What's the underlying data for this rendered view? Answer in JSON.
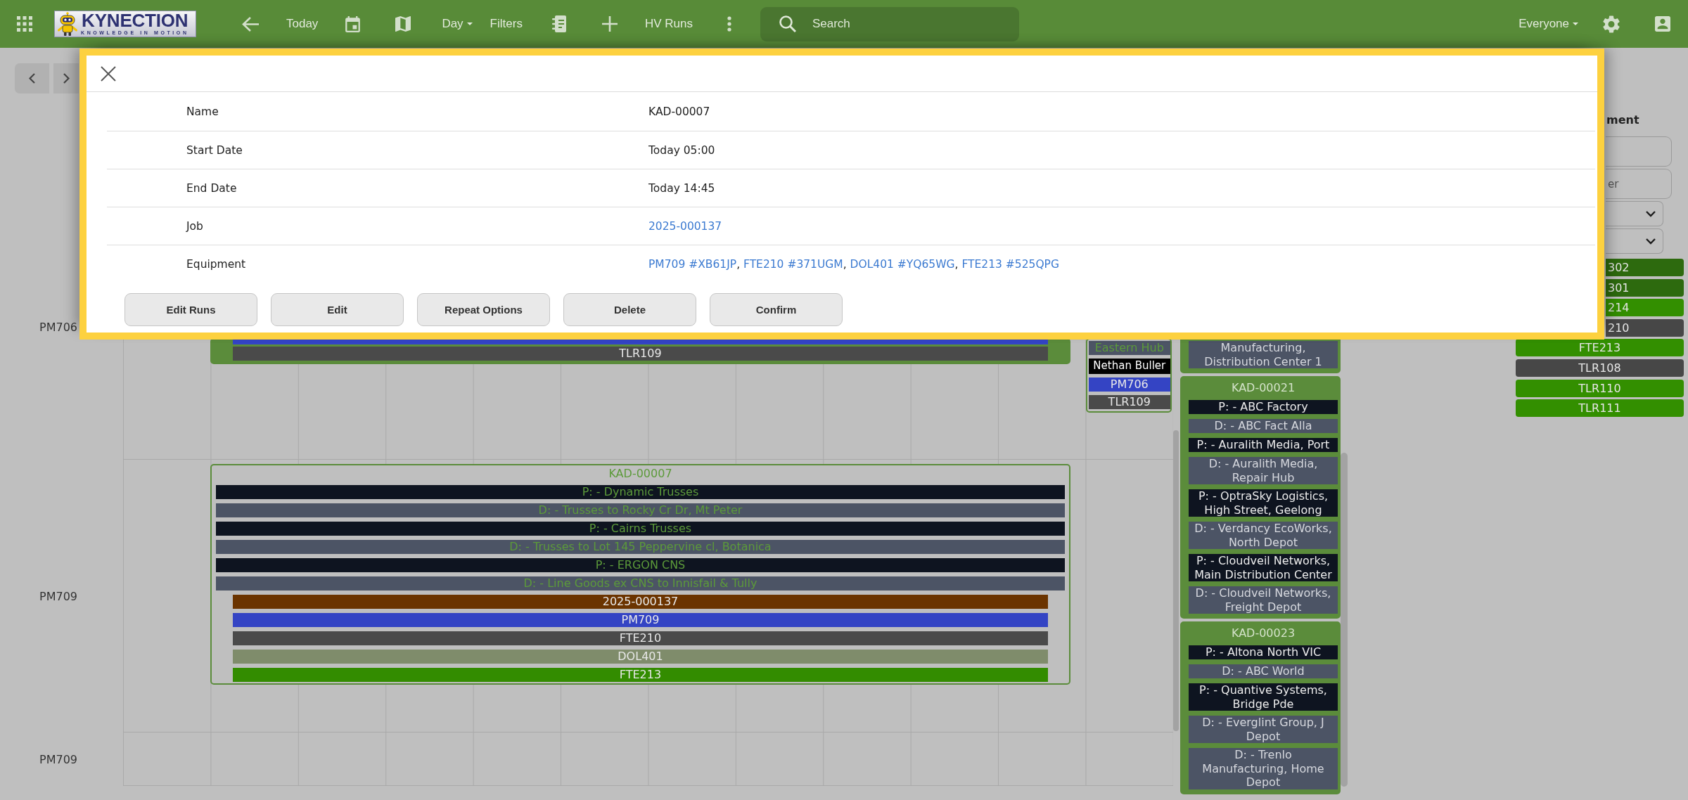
{
  "top_bar": {
    "logo": {
      "wordmark": "KYNECTION",
      "tagline": "KNOWLEDGE IN MOTION"
    },
    "today": "Today",
    "view": "Day",
    "filters": "Filters",
    "runs": "HV Runs",
    "search": {
      "placeholder": "Search"
    },
    "user_filter": "Everyone"
  },
  "calendar": {
    "rows": [
      {
        "label": "PM706",
        "cards": [
          {
            "confirmed": true,
            "items": [
              {
                "kind": "equipment",
                "color": "#3444c4"
              },
              {
                "kind": "equipment",
                "label": "TLR109",
                "color": "#4a4a4a"
              }
            ]
          },
          {
            "confirmed": false,
            "items": [
              {
                "kind": "drop",
                "label": "Eastern Hub"
              },
              {
                "kind": "driver",
                "label": "Nethan Buller"
              },
              {
                "kind": "equipment",
                "label": "PM706",
                "color": "#3444c4"
              },
              {
                "kind": "equipment",
                "label": "TLR109",
                "color": "#4a4a4a"
              }
            ]
          }
        ]
      },
      {
        "label": "PM709",
        "cards": [
          {
            "title": "KAD-00007",
            "confirmed": false,
            "items": [
              {
                "kind": "pickup",
                "label": "P: - Dynamic Trusses"
              },
              {
                "kind": "drop",
                "label": "D: - Trusses to Rocky Cr Dr, Mt Peter"
              },
              {
                "kind": "pickup",
                "label": "P: - Cairns Trusses"
              },
              {
                "kind": "drop",
                "label": "D: - Trusses to Lot 145 Peppervine cl, Botanica"
              },
              {
                "kind": "pickup",
                "label": "P: - ERGON CNS"
              },
              {
                "kind": "drop",
                "label": "D: - Line Goods ex CNS to Innisfail & Tully"
              },
              {
                "kind": "equipment",
                "label": "2025-000137",
                "color": "#6b3400"
              },
              {
                "kind": "equipment",
                "label": "PM709",
                "color": "#3444c4"
              },
              {
                "kind": "equipment",
                "label": "FTE210",
                "color": "#4a4a4a"
              },
              {
                "kind": "equipment",
                "label": "DOL401",
                "color": "#7f8c6b"
              },
              {
                "kind": "equipment",
                "label": "FTE213",
                "color": "#338c00"
              }
            ]
          }
        ]
      },
      {
        "label": "PM709"
      }
    ]
  },
  "unassigned": {
    "cards": [
      {
        "confirmed": true,
        "items": [
          {
            "kind": "drop",
            "label": "Manufacturing, Distribution Center 1"
          }
        ]
      },
      {
        "title": "KAD-00021",
        "confirmed": true,
        "items": [
          {
            "kind": "pickup",
            "label": "P: - ABC Factory"
          },
          {
            "kind": "drop",
            "label": "D: - ABC Fact Alla"
          },
          {
            "kind": "pickup",
            "label": "P: - Auralith Media, Port"
          },
          {
            "kind": "drop",
            "label": "D: - Auralith Media, Repair Hub"
          },
          {
            "kind": "pickup",
            "label": "P: - OptraSky Logistics, High Street, Geelong"
          },
          {
            "kind": "drop",
            "label": "D: - Verdancy EcoWorks, North Depot"
          },
          {
            "kind": "pickup",
            "label": "P: - Cloudveil Networks, Main Distribution Center"
          },
          {
            "kind": "drop",
            "label": "D: - Cloudveil Networks, Freight Depot"
          }
        ]
      },
      {
        "title": "KAD-00023",
        "confirmed": true,
        "items": [
          {
            "kind": "pickup",
            "label": "P: - Altona North VIC"
          },
          {
            "kind": "drop",
            "label": "D: - ABC World"
          },
          {
            "kind": "pickup",
            "label": "P: - Quantive Systems, Bridge Pde"
          },
          {
            "kind": "drop",
            "label": "D: - Everglint Group, J Depot"
          },
          {
            "kind": "drop",
            "label": "D: - Trenlo Manufacturing, Home Depot"
          }
        ]
      }
    ]
  },
  "equipment_panel": {
    "heading": "ment",
    "fields": [
      {
        "kind": "input"
      },
      {
        "kind": "input",
        "placeholder": "er"
      },
      {
        "kind": "select"
      },
      {
        "kind": "select"
      }
    ],
    "tags": [
      {
        "label": "302",
        "color": "#2d6a0e",
        "covered": true
      },
      {
        "label": "301",
        "color": "#2d6a0e",
        "covered": true
      },
      {
        "label": "214",
        "color": "#338f00",
        "covered": true
      },
      {
        "label": "210",
        "color": "#474747",
        "covered": true
      },
      {
        "label": "FTE213",
        "color": "#338f00",
        "covered": false
      },
      {
        "label": "TLR108",
        "color": "#474747",
        "covered": false
      },
      {
        "label": "TLR110",
        "color": "#338f00",
        "covered": false
      },
      {
        "label": "TLR111",
        "color": "#338f00",
        "covered": false
      }
    ]
  },
  "dialog": {
    "fields": [
      {
        "label": "Name",
        "parts": [
          {
            "kind": "text",
            "text": "KAD-00007"
          }
        ]
      },
      {
        "label": "Start Date",
        "parts": [
          {
            "kind": "text",
            "text": "Today 05:00"
          }
        ]
      },
      {
        "label": "End Date",
        "parts": [
          {
            "kind": "text",
            "text": "Today 14:45"
          }
        ]
      },
      {
        "label": "Job",
        "parts": [
          {
            "kind": "link",
            "text": "2025-000137"
          }
        ]
      },
      {
        "label": "Equipment",
        "parts": [
          {
            "kind": "link",
            "text": "PM709 #XB61JP"
          },
          {
            "kind": "text",
            "text": ", "
          },
          {
            "kind": "link",
            "text": "FTE210 #371UGM"
          },
          {
            "kind": "text",
            "text": ", "
          },
          {
            "kind": "link",
            "text": "DOL401 #YQ65WG"
          },
          {
            "kind": "text",
            "text": ", "
          },
          {
            "kind": "link",
            "text": "FTE213 #525QPG"
          }
        ]
      }
    ],
    "buttons": [
      "Edit Runs",
      "Edit",
      "Repeat Options",
      "Delete",
      "Confirm"
    ]
  }
}
